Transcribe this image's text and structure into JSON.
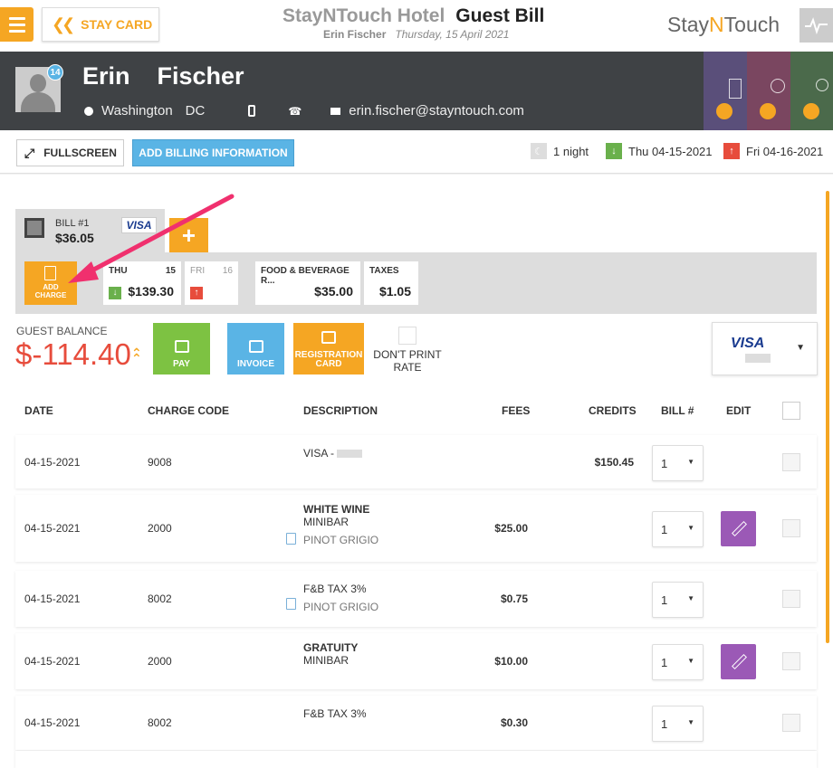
{
  "header": {
    "menu_icon": "hamburger-icon",
    "back_label": "STAY CARD",
    "hotel_name": "StayNTouch Hotel",
    "page_title": "Guest Bill",
    "guest_name": "Erin Fischer",
    "date": "Thursday, 15 April 2021",
    "brand_left": "Stay",
    "brand_n": "N",
    "brand_right": "Touch",
    "brand_color": "#f5a623",
    "pulse_icon": "activity-icon"
  },
  "guest": {
    "first_name": "Erin",
    "last_name": "Fischer",
    "badge_count": "14",
    "city": "Washington",
    "state": "DC",
    "email": "erin.fischer@stayntouch.com",
    "tiles": [
      {
        "color": "#5a4f7a",
        "icon": "building-icon"
      },
      {
        "color": "#7a4660",
        "icon": "globe-icon"
      },
      {
        "color": "#4b6a4b",
        "icon": "circles-icon"
      }
    ]
  },
  "actions": {
    "fullscreen_label": "FULLSCREEN",
    "add_billing_label": "ADD BILLING INFORMATION",
    "nights": "1 night",
    "arrival": "Thu 04-15-2021",
    "departure": "Fri 04-16-2021"
  },
  "bill": {
    "bill_label": "BILL #1",
    "bill_amount": "$36.05",
    "card_brand": "VISA",
    "add_bill_symbol": "+",
    "add_charge_label_1": "ADD",
    "add_charge_label_2": "CHARGE",
    "days": [
      {
        "day": "THU",
        "num": "15",
        "value": "$139.30",
        "arrow": "↓",
        "arrow_color": "#6ab04c"
      },
      {
        "day": "FRI",
        "num": "16",
        "value": "",
        "arrow": "↑",
        "arrow_color": "#e74c3c"
      }
    ],
    "categories": [
      {
        "label": "FOOD & BEVERAGE R...",
        "value": "$35.00"
      },
      {
        "label": "TAXES",
        "value": "$1.05"
      }
    ]
  },
  "balance": {
    "label": "GUEST BALANCE",
    "amount": "$-114.40",
    "buttons": [
      {
        "label": "PAY",
        "label2": "",
        "color": "#7dc242",
        "icon": "wallet-icon"
      },
      {
        "label": "INVOICE",
        "label2": "",
        "color": "#5ab4e5",
        "icon": "invoice-icon"
      },
      {
        "label": "REGISTRATION",
        "label2": "CARD",
        "color": "#f5a623",
        "icon": "printer-icon"
      }
    ],
    "dont_print_1": "DON'T PRINT",
    "dont_print_2": "RATE",
    "card_select": "VISA"
  },
  "table": {
    "headers": [
      "DATE",
      "CHARGE CODE",
      "DESCRIPTION",
      "FEES",
      "CREDITS",
      "BILL #",
      "EDIT"
    ],
    "rows": [
      {
        "date": "04-15-2021",
        "code": "9008",
        "title": "",
        "line1": "VISA - ",
        "line2": "",
        "fee": "",
        "credit": "$150.45",
        "bill": "1",
        "editable": false
      },
      {
        "date": "04-15-2021",
        "code": "2000",
        "title": "WHITE WINE",
        "line1": "MINIBAR",
        "line2": "PINOT GRIGIO",
        "fee": "$25.00",
        "credit": "",
        "bill": "1",
        "editable": true
      },
      {
        "date": "04-15-2021",
        "code": "8002",
        "title": "",
        "line1": "F&B TAX 3%",
        "line2": "PINOT GRIGIO",
        "fee": "$0.75",
        "credit": "",
        "bill": "1",
        "editable": false
      },
      {
        "date": "04-15-2021",
        "code": "2000",
        "title": "GRATUITY",
        "line1": "MINIBAR",
        "line2": "",
        "fee": "$10.00",
        "credit": "",
        "bill": "1",
        "editable": true
      },
      {
        "date": "04-15-2021",
        "code": "8002",
        "title": "",
        "line1": "F&B TAX 3%",
        "line2": "",
        "fee": "$0.30",
        "credit": "",
        "bill": "1",
        "editable": false
      }
    ]
  },
  "annotation": {
    "color": "#f0306e"
  }
}
